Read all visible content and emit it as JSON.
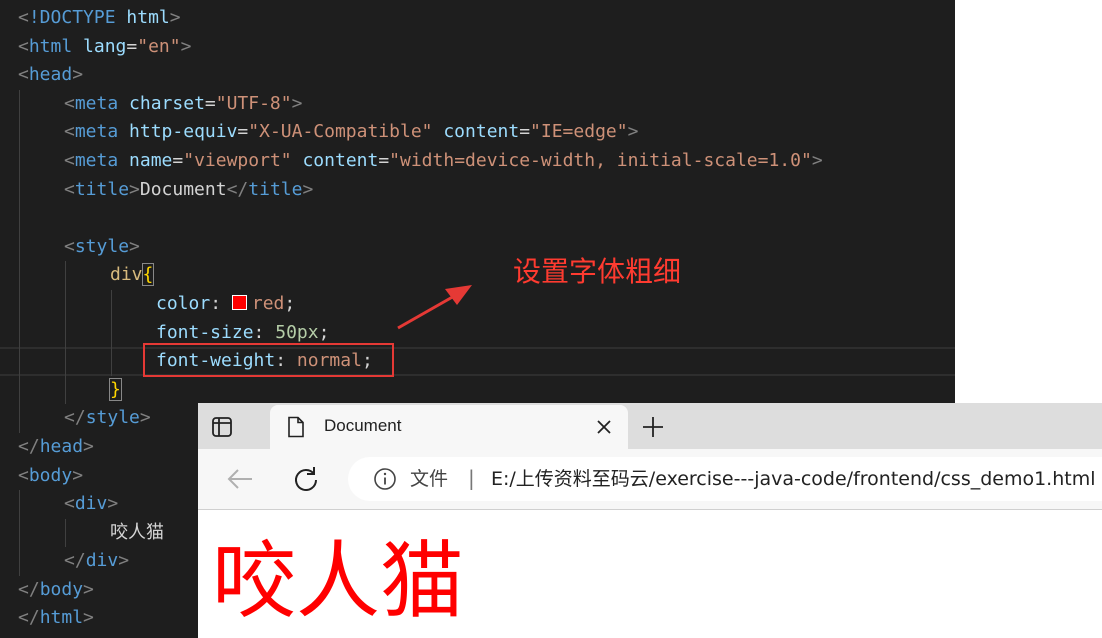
{
  "editor": {
    "lines": [
      {
        "indent": 0,
        "tokens": [
          [
            "punct",
            "<"
          ],
          [
            "tag",
            "!DOCTYPE"
          ],
          [
            "text",
            " "
          ],
          [
            "attr",
            "html"
          ],
          [
            "punct",
            ">"
          ]
        ]
      },
      {
        "indent": 0,
        "tokens": [
          [
            "punct",
            "<"
          ],
          [
            "tag",
            "html"
          ],
          [
            "text",
            " "
          ],
          [
            "attr",
            "lang"
          ],
          [
            "eq",
            "="
          ],
          [
            "str",
            "\"en\""
          ],
          [
            "punct",
            ">"
          ]
        ]
      },
      {
        "indent": 0,
        "tokens": [
          [
            "punct",
            "<"
          ],
          [
            "tag",
            "head"
          ],
          [
            "punct",
            ">"
          ]
        ]
      },
      {
        "indent": 1,
        "tokens": [
          [
            "punct",
            "<"
          ],
          [
            "tag",
            "meta"
          ],
          [
            "text",
            " "
          ],
          [
            "attr",
            "charset"
          ],
          [
            "eq",
            "="
          ],
          [
            "str",
            "\"UTF-8\""
          ],
          [
            "punct",
            ">"
          ]
        ]
      },
      {
        "indent": 1,
        "tokens": [
          [
            "punct",
            "<"
          ],
          [
            "tag",
            "meta"
          ],
          [
            "text",
            " "
          ],
          [
            "attr",
            "http-equiv"
          ],
          [
            "eq",
            "="
          ],
          [
            "str",
            "\"X-UA-Compatible\""
          ],
          [
            "text",
            " "
          ],
          [
            "attr",
            "content"
          ],
          [
            "eq",
            "="
          ],
          [
            "str",
            "\"IE=edge\""
          ],
          [
            "punct",
            ">"
          ]
        ]
      },
      {
        "indent": 1,
        "tokens": [
          [
            "punct",
            "<"
          ],
          [
            "tag",
            "meta"
          ],
          [
            "text",
            " "
          ],
          [
            "attr",
            "name"
          ],
          [
            "eq",
            "="
          ],
          [
            "str",
            "\"viewport\""
          ],
          [
            "text",
            " "
          ],
          [
            "attr",
            "content"
          ],
          [
            "eq",
            "="
          ],
          [
            "str",
            "\"width=device-width, initial-scale=1.0\""
          ],
          [
            "punct",
            ">"
          ]
        ]
      },
      {
        "indent": 1,
        "tokens": [
          [
            "punct",
            "<"
          ],
          [
            "tag",
            "title"
          ],
          [
            "punct",
            ">"
          ],
          [
            "text",
            "Document"
          ],
          [
            "punct",
            "</"
          ],
          [
            "tag",
            "title"
          ],
          [
            "punct",
            ">"
          ]
        ]
      },
      {
        "indent": 1,
        "tokens": []
      },
      {
        "indent": 1,
        "tokens": [
          [
            "punct",
            "<"
          ],
          [
            "tag",
            "style"
          ],
          [
            "punct",
            ">"
          ]
        ]
      },
      {
        "indent": 2,
        "tokens": [
          [
            "sel",
            "div"
          ],
          [
            "brace-box",
            "{"
          ]
        ]
      },
      {
        "indent": 3,
        "tokens": [
          [
            "prop",
            "color"
          ],
          [
            "text",
            ": "
          ],
          [
            "swatch",
            ""
          ],
          [
            "str",
            "red"
          ],
          [
            "text",
            ";"
          ]
        ]
      },
      {
        "indent": 3,
        "tokens": [
          [
            "prop",
            "font-size"
          ],
          [
            "text",
            ": "
          ],
          [
            "num",
            "50px"
          ],
          [
            "text",
            ";"
          ]
        ]
      },
      {
        "indent": 3,
        "current": true,
        "tokens": [
          [
            "prop",
            "font-weight"
          ],
          [
            "text",
            ": "
          ],
          [
            "str",
            "normal"
          ],
          [
            "text",
            ";"
          ]
        ]
      },
      {
        "indent": 2,
        "tokens": [
          [
            "brace-box",
            "}"
          ]
        ]
      },
      {
        "indent": 1,
        "tokens": [
          [
            "punct",
            "</"
          ],
          [
            "tag",
            "style"
          ],
          [
            "punct",
            ">"
          ]
        ]
      },
      {
        "indent": 0,
        "tokens": [
          [
            "punct",
            "</"
          ],
          [
            "tag",
            "head"
          ],
          [
            "punct",
            ">"
          ]
        ]
      },
      {
        "indent": 0,
        "tokens": [
          [
            "punct",
            "<"
          ],
          [
            "tag",
            "body"
          ],
          [
            "punct",
            ">"
          ]
        ]
      },
      {
        "indent": 1,
        "tokens": [
          [
            "punct",
            "<"
          ],
          [
            "tag",
            "div"
          ],
          [
            "punct",
            ">"
          ]
        ]
      },
      {
        "indent": 2,
        "tokens": [
          [
            "text",
            "咬人猫"
          ]
        ]
      },
      {
        "indent": 1,
        "tokens": [
          [
            "punct",
            "</"
          ],
          [
            "tag",
            "div"
          ],
          [
            "punct",
            ">"
          ]
        ]
      },
      {
        "indent": 0,
        "tokens": [
          [
            "punct",
            "</"
          ],
          [
            "tag",
            "body"
          ],
          [
            "punct",
            ">"
          ]
        ]
      },
      {
        "indent": 0,
        "tokens": [
          [
            "punct",
            "</"
          ],
          [
            "tag",
            "html"
          ],
          [
            "punct",
            ">"
          ]
        ]
      }
    ]
  },
  "annotation": {
    "label": "设置字体粗细",
    "color": "#ff3b30"
  },
  "browser": {
    "tab_title": "Document",
    "new_tab_symbol": "+",
    "site_info_label": "文件",
    "separator": "|",
    "url": "E:/上传资料至码云/exercise---java-code/frontend/css_demo1.html",
    "page_text": "咬人猫",
    "page_text_color": "#ff0000"
  },
  "icons": {
    "tab_actions": "tab-actions-icon",
    "favicon": "page-icon",
    "close": "close-icon",
    "new_tab": "plus-icon",
    "back": "back-arrow-icon",
    "refresh": "refresh-icon",
    "info": "info-icon"
  }
}
